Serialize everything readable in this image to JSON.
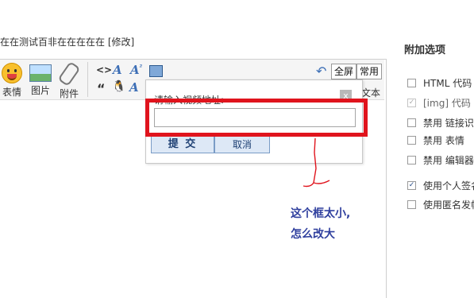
{
  "title": "在在测试百非在在在在在 [修改]",
  "toolbar": {
    "emoji_label": "表情",
    "image_label": "图片",
    "attach_label": "附件",
    "code_icon": "<>",
    "quote_icon": "“",
    "fullscreen_label": "全屏",
    "common_label": "常用",
    "text_label": "文本"
  },
  "popup": {
    "label": "请输入视频地址:",
    "input_value": "",
    "close_icon": "x",
    "submit_label": "提 交",
    "cancel_label": "取消"
  },
  "annotation": {
    "line1": "这个框太小,",
    "line2": "怎么改大"
  },
  "sidebar": {
    "title": "附加选项",
    "options": [
      {
        "label": "HTML 代码",
        "checked": false,
        "disabled": false
      },
      {
        "label": "[img] 代码",
        "checked": true,
        "disabled": true
      },
      {
        "label": "禁用  链接识",
        "checked": false,
        "disabled": false
      },
      {
        "label": "禁用  表情",
        "checked": false,
        "disabled": false
      },
      {
        "label": "禁用  编辑器",
        "checked": false,
        "disabled": false
      },
      {
        "label": "使用个人签名",
        "checked": true,
        "disabled": false
      },
      {
        "label": "使用匿名发帖",
        "checked": false,
        "disabled": false
      }
    ]
  },
  "colors": {
    "highlight": "#e0141d",
    "annotation": "#2f3f9e",
    "button_bg": "#dde8f6"
  }
}
